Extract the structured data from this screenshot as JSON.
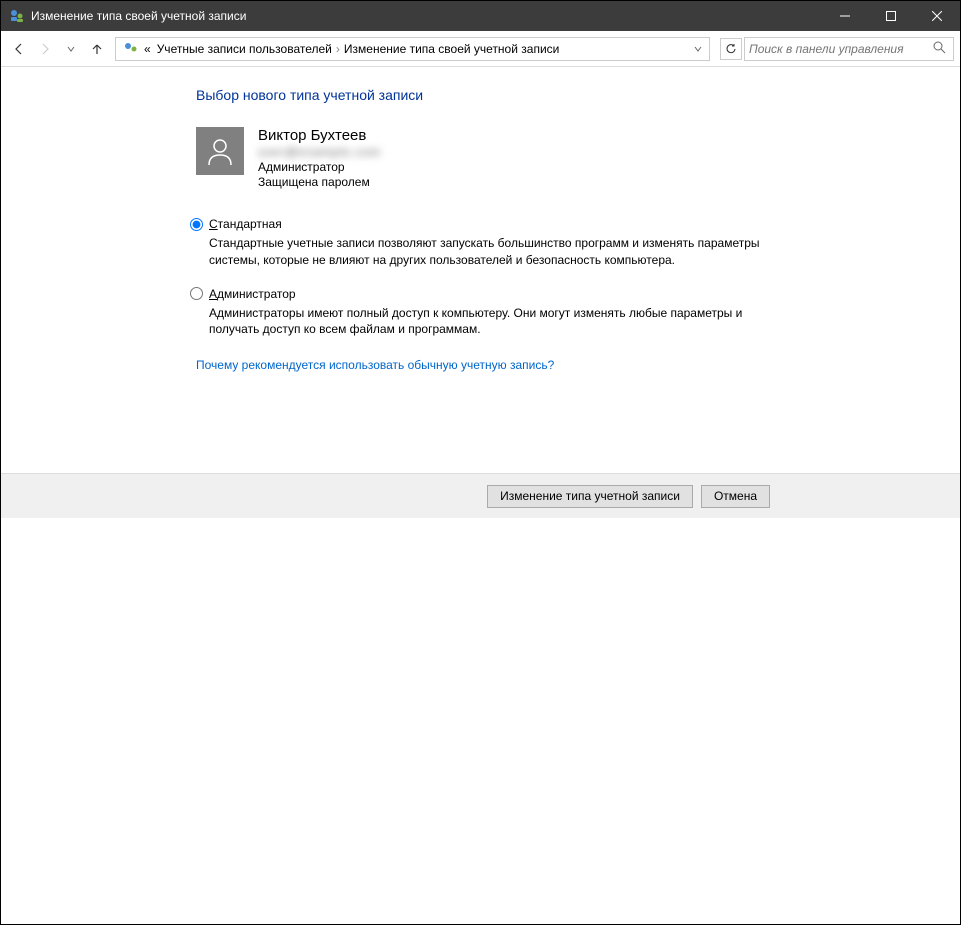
{
  "titlebar": {
    "title": "Изменение типа своей учетной записи"
  },
  "breadcrumb": {
    "prefix": "«",
    "item1": "Учетные записи пользователей",
    "item2": "Изменение типа своей учетной записи"
  },
  "search": {
    "placeholder": "Поиск в панели управления"
  },
  "page": {
    "heading": "Выбор нового типа учетной записи"
  },
  "user": {
    "name": "Виктор Бухтеев",
    "email": "user@example.com",
    "role": "Администратор",
    "protected": "Защищена паролем"
  },
  "options": {
    "standard": {
      "label_pre": "С",
      "label_rest": "тандартная",
      "desc": "Стандартные учетные записи позволяют запускать большинство программ и изменять параметры системы, которые не влияют на других пользователей и безопасность компьютера."
    },
    "admin": {
      "label_pre": "А",
      "label_rest": "дминистратор",
      "desc": "Администраторы имеют полный доступ к компьютеру. Они могут изменять любые параметры и получать доступ ко всем файлам и программам."
    }
  },
  "help_link": "Почему рекомендуется использовать обычную учетную запись?",
  "buttons": {
    "change": "Изменение типа учетной записи",
    "cancel": "Отмена"
  }
}
